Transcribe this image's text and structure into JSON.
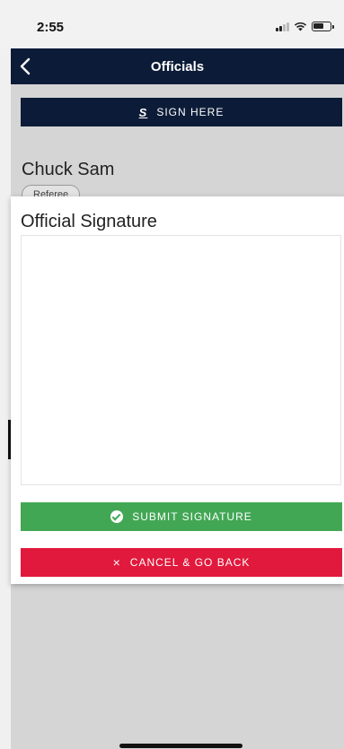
{
  "status_bar": {
    "time": "2:55"
  },
  "navbar": {
    "title": "Officials"
  },
  "sign_here": {
    "label": "SIGN HERE",
    "icon_glyph": "S"
  },
  "official": {
    "name": "Chuck Sam",
    "role": "Referee"
  },
  "modal": {
    "title": "Official Signature",
    "submit_label": "SUBMIT SIGNATURE",
    "cancel_label": "CANCEL & GO BACK",
    "cancel_glyph": "×"
  },
  "colors": {
    "navy": "#0c1c38",
    "submit_green": "#42a755",
    "cancel_red": "#e1193c"
  }
}
